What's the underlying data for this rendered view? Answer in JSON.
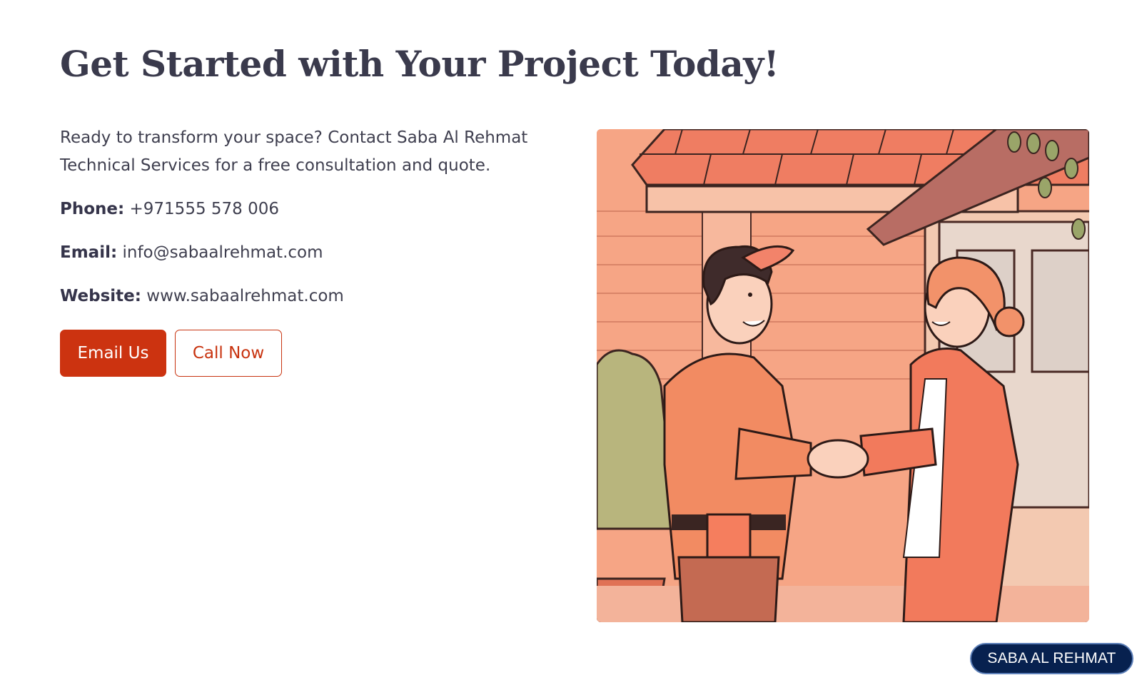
{
  "page": {
    "title": "Get Started with Your Project Today!",
    "intro": "Ready to transform your space? Contact Saba Al Rehmat Technical Services for a free consultation and quote."
  },
  "contact": {
    "phone_label": "Phone:",
    "phone_value": "+971555 578 006",
    "email_label": "Email:",
    "email_value": "info@sabaalrehmat.com",
    "website_label": "Website:",
    "website_value": "www.sabaalrehmat.com"
  },
  "buttons": {
    "email_us": "Email Us",
    "call_now": "Call Now"
  },
  "brand": {
    "badge_text": "SABA AL REHMAT"
  },
  "colors": {
    "accent": "#cc3310",
    "heading": "#3a3a4c",
    "badge_bg": "#07214f"
  }
}
